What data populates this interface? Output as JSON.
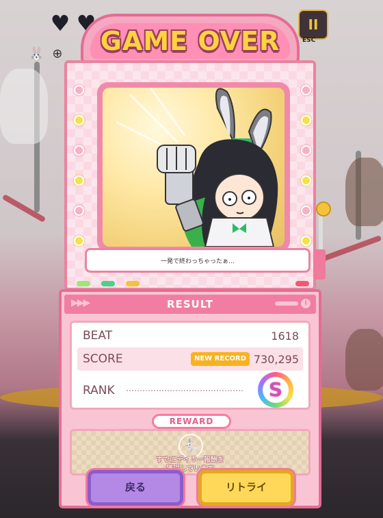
{
  "hud": {
    "hearts": [
      "♥",
      "♥"
    ],
    "pause_glyph": "II",
    "esc_label": "ESC"
  },
  "banner": {
    "title": "GAME OVER"
  },
  "dialog": {
    "line": "一発で終わっちゃったぁ…"
  },
  "result": {
    "title": "RESULT",
    "beat_label": "BEAT",
    "beat_value": "1618",
    "score_label": "SCORE",
    "new_record_label": "NEW RECORD",
    "score_value": "730,295",
    "rank_label": "RANK",
    "rank_value": "S"
  },
  "reward": {
    "title": "REWARD",
    "message_line1": "すでにデイリー報酬を",
    "message_line2": "獲得しています"
  },
  "buttons": {
    "back": "戻る",
    "retry": "リトライ"
  },
  "colors": {
    "accent_pink": "#e56c93",
    "title_yellow": "#ffd23f",
    "back_button": "#b489e6",
    "retry_button": "#ffd85a",
    "new_record": "#f7b21f"
  }
}
